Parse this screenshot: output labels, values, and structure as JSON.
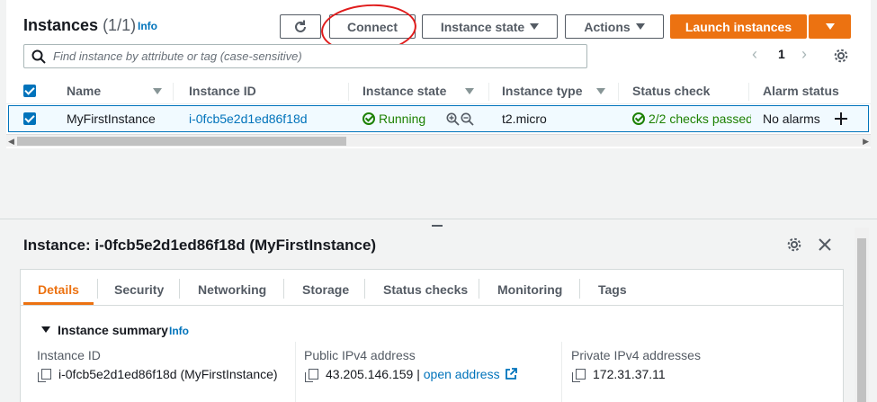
{
  "header": {
    "title": "Instances",
    "count": "(1/1)",
    "info": "Info"
  },
  "toolbar": {
    "connect": "Connect",
    "instance_state": "Instance state",
    "actions": "Actions",
    "launch": "Launch instances"
  },
  "search": {
    "placeholder": "Find instance by attribute or tag (case-sensitive)"
  },
  "pagination": {
    "page": "1"
  },
  "table": {
    "columns": [
      "Name",
      "Instance ID",
      "Instance state",
      "Instance type",
      "Status check",
      "Alarm status"
    ],
    "rows": [
      {
        "name": "MyFirstInstance",
        "instance_id": "i-0fcb5e2d1ed86f18d",
        "state": "Running",
        "type": "t2.micro",
        "status_check": "2/2 checks passed",
        "alarm": "No alarms"
      }
    ]
  },
  "detail": {
    "title": "Instance: i-0fcb5e2d1ed86f18d (MyFirstInstance)",
    "tabs": [
      "Details",
      "Security",
      "Networking",
      "Storage",
      "Status checks",
      "Monitoring",
      "Tags"
    ],
    "summary_title": "Instance summary",
    "summary_info": "Info",
    "fields": [
      {
        "label": "Instance ID",
        "value": "i-0fcb5e2d1ed86f18d (MyFirstInstance)"
      },
      {
        "label": "Public IPv4 address",
        "value": "43.205.146.159",
        "separator": "|",
        "link": "open address"
      },
      {
        "label": "Private IPv4 addresses",
        "value": "172.31.37.11"
      }
    ]
  },
  "colors": {
    "accent": "#ec7211",
    "link": "#0073bb",
    "success": "#1d8102",
    "annotation": "#e01b1b"
  },
  "icons": [
    "refresh-icon",
    "caret-down-icon",
    "search-icon",
    "chevron-left-icon",
    "chevron-right-icon",
    "gear-icon",
    "check-circle-icon",
    "zoom-in-icon",
    "zoom-out-icon",
    "plus-icon",
    "close-icon",
    "copy-icon",
    "external-link-icon"
  ]
}
